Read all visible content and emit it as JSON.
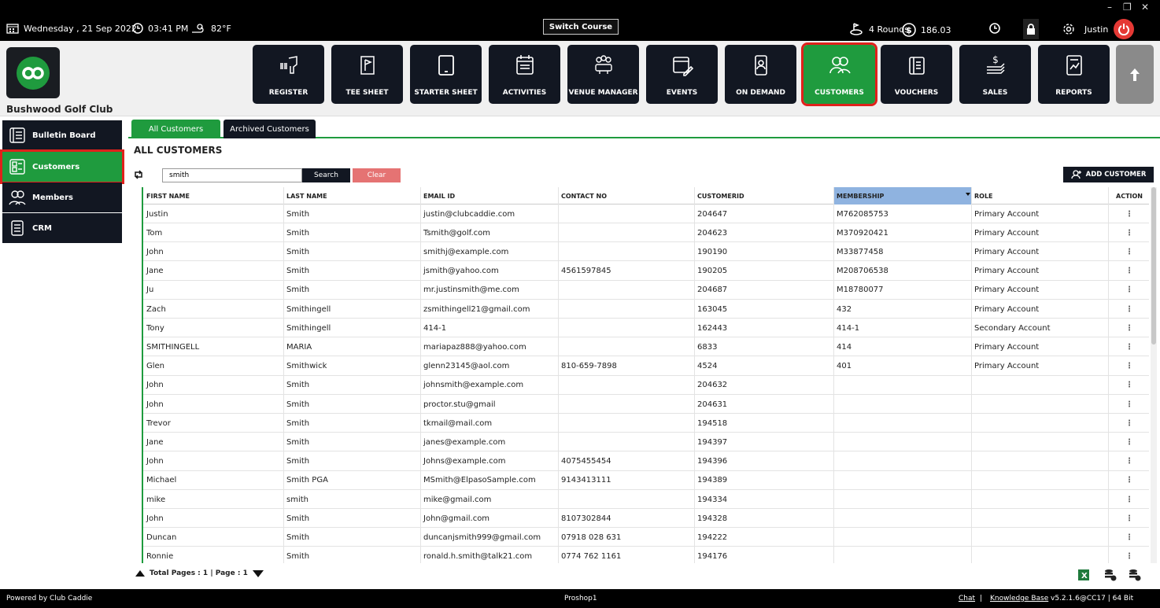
{
  "topbar": {
    "date": "Wednesday , 21 Sep 2022",
    "time": "03:41 PM",
    "weather": "82°F",
    "switch_course": "Switch Course",
    "rounds": "4 Rounds",
    "balance": "186.03",
    "user": "Justin",
    "window_controls": [
      "–",
      "❐",
      "✕"
    ]
  },
  "club": {
    "name": "Bushwood Golf Club"
  },
  "nav": [
    {
      "label": "REGISTER",
      "icon": "barcode-scanner-icon"
    },
    {
      "label": "TEE SHEET",
      "icon": "flag-sheet-icon"
    },
    {
      "label": "STARTER SHEET",
      "icon": "tablet-icon"
    },
    {
      "label": "ACTIVITIES",
      "icon": "calendar-list-icon"
    },
    {
      "label": "VENUE MANAGER",
      "icon": "people-table-icon"
    },
    {
      "label": "EVENTS",
      "icon": "calendar-edit-icon"
    },
    {
      "label": "ON DEMAND",
      "icon": "mobile-user-icon"
    },
    {
      "label": "CUSTOMERS",
      "icon": "customers-icon",
      "active": true
    },
    {
      "label": "VOUCHERS",
      "icon": "voucher-icon"
    },
    {
      "label": "SALES",
      "icon": "money-icon"
    },
    {
      "label": "REPORTS",
      "icon": "report-icon"
    }
  ],
  "sidebar": [
    {
      "label": "Bulletin Board",
      "icon": "bulletin-board-icon"
    },
    {
      "label": "Customers",
      "icon": "customer-list-icon",
      "active": true
    },
    {
      "label": "Members",
      "icon": "members-icon"
    },
    {
      "label": "CRM",
      "icon": "crm-icon"
    }
  ],
  "tabs": [
    {
      "label": "All Customers",
      "active": true
    },
    {
      "label": "Archived Customers",
      "active": false
    }
  ],
  "page_title": "ALL CUSTOMERS",
  "search": {
    "value": "smith",
    "button": "Search",
    "clear": "Clear"
  },
  "add_customer": "ADD CUSTOMER",
  "table": {
    "columns": [
      "FIRST NAME",
      "LAST NAME",
      "EMAIL ID",
      "CONTACT NO",
      "CUSTOMERID",
      "MEMBERSHIP",
      "ROLE",
      "ACTION"
    ],
    "rows": [
      [
        "Justin",
        "Smith",
        "justin@clubcaddie.com",
        "",
        "204647",
        "M762085753",
        "Primary Account",
        "⋮"
      ],
      [
        "Tom",
        "Smith",
        "Tsmith@golf.com",
        "",
        "204623",
        "M370920421",
        "Primary Account",
        "⋮"
      ],
      [
        "John",
        "Smith",
        "smithj@example.com",
        "",
        "190190",
        "M33877458",
        "Primary Account",
        "⋮"
      ],
      [
        "Jane",
        "Smith",
        "jsmith@yahoo.com",
        "4561597845",
        "190205",
        "M208706538",
        "Primary Account",
        "⋮"
      ],
      [
        "Ju",
        "Smith",
        "mr.justinsmith@me.com",
        "",
        "204687",
        "M18780077",
        "Primary Account",
        "⋮"
      ],
      [
        "Zach",
        "Smithingell",
        "zsmithingell21@gmail.com",
        "",
        "163045",
        "432",
        "Primary Account",
        "⋮"
      ],
      [
        "Tony",
        "Smithingell",
        "414-1",
        "",
        "162443",
        "414-1",
        "Secondary Account",
        "⋮"
      ],
      [
        "SMITHINGELL",
        "MARIA",
        "mariapaz888@yahoo.com",
        "",
        "6833",
        "414",
        "Primary Account",
        "⋮"
      ],
      [
        "Glen",
        "Smithwick",
        "glenn23145@aol.com",
        "810-659-7898",
        "4524",
        "401",
        "Primary Account",
        "⋮"
      ],
      [
        "John",
        "Smith",
        "johnsmith@example.com",
        "",
        "204632",
        "",
        "",
        "⋮"
      ],
      [
        "John",
        "Smith",
        "proctor.stu@gmail",
        "",
        "204631",
        "",
        "",
        "⋮"
      ],
      [
        "Trevor",
        "Smith",
        "tkmail@mail.com",
        "",
        "194518",
        "",
        "",
        "⋮"
      ],
      [
        "Jane",
        "Smith",
        "janes@example.com",
        "",
        "194397",
        "",
        "",
        "⋮"
      ],
      [
        "John",
        "Smith",
        "Johns@example.com",
        "4075455454",
        "194396",
        "",
        "",
        "⋮"
      ],
      [
        "Michael",
        "Smith PGA",
        "MSmith@ElpasoSample.com",
        "9143413111",
        "194389",
        "",
        "",
        "⋮"
      ],
      [
        "mike",
        "smith",
        "mike@gmail.com",
        "",
        "194334",
        "",
        "",
        "⋮"
      ],
      [
        "John",
        "Smith",
        "John@gmail.com",
        "8107302844",
        "194328",
        "",
        "",
        "⋮"
      ],
      [
        "Duncan",
        "Smith",
        "duncanjsmith999@gmail.com",
        "07918 028 631",
        "194222",
        "",
        "",
        "⋮"
      ],
      [
        "Ronnie",
        "Smith",
        "ronald.h.smith@talk21.com",
        "0774 762 1161",
        "194176",
        "",
        "",
        "⋮"
      ]
    ]
  },
  "pager": {
    "text": "Total Pages : 1 | Page : 1"
  },
  "footer": {
    "powered": "Powered by Club Caddie",
    "station": "Proshop1",
    "chat": "Chat",
    "sep": "|",
    "kb": "Knowledge Base",
    "version": "v5.2.1.6@CC17  |  64 Bit"
  },
  "colors": {
    "brand_green": "#1f9b3e",
    "nav_dark": "#121722",
    "highlight_red": "#e0211b",
    "clear_red": "#e57373",
    "membership_header": "#8fb3e0"
  }
}
